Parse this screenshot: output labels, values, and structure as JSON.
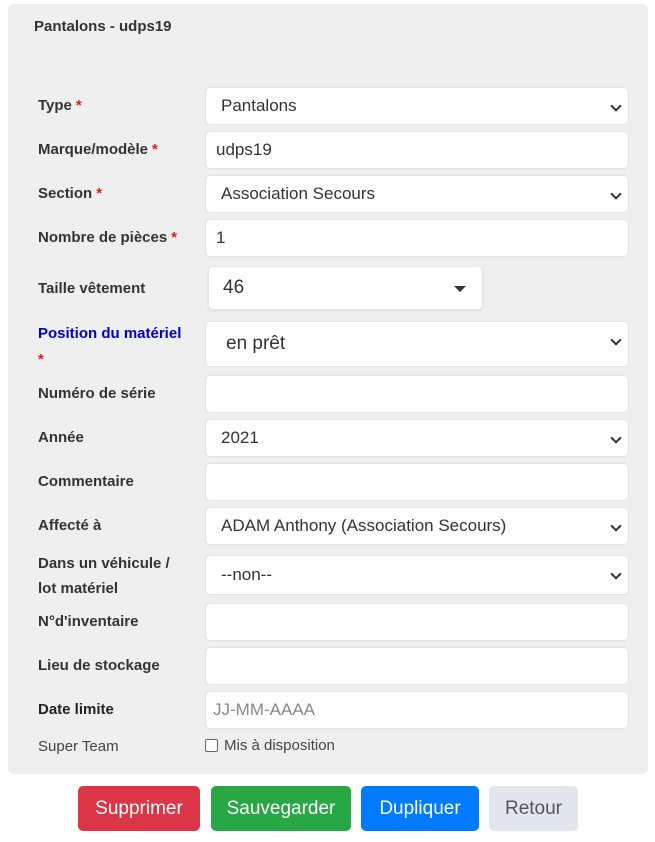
{
  "card": {
    "title": "Pantalons - udps19"
  },
  "form": {
    "type": {
      "label": "Type",
      "required_mark": "*",
      "value": "Pantalons"
    },
    "brand_model": {
      "label": "Marque/modèle",
      "required_mark": "*",
      "value": "udps19"
    },
    "section": {
      "label": "Section",
      "required_mark": "*",
      "value": "Association Secours"
    },
    "pieces": {
      "label": "Nombre de pièces",
      "required_mark": "*",
      "value": "1"
    },
    "size": {
      "label": "Taille vêtement",
      "value": "46"
    },
    "position": {
      "label": "Position du matériel",
      "required_mark": "*",
      "value": "en prêt"
    },
    "serial": {
      "label": "Numéro de série",
      "value": ""
    },
    "year": {
      "label": "Année",
      "value": "2021"
    },
    "comment": {
      "label": "Commentaire",
      "value": ""
    },
    "assigned": {
      "label": "Affecté à",
      "value": "ADAM Anthony (Association Secours)"
    },
    "vehicle": {
      "label_line1": "Dans un véhicule /",
      "label_line2": "lot matériel",
      "value": "--non--"
    },
    "inventory": {
      "label": "N°d'inventaire",
      "value": ""
    },
    "storage": {
      "label": "Lieu de stockage",
      "value": ""
    },
    "deadline": {
      "label": "Date limite",
      "placeholder": "JJ-MM-AAAA",
      "value": ""
    },
    "super_team": {
      "label": "Super Team",
      "checkbox_label": "Mis à disposition",
      "checked": false
    }
  },
  "buttons": {
    "delete": {
      "label": "Supprimer",
      "color": "#dc3545"
    },
    "save": {
      "label": "Sauvegarder",
      "color": "#28a745"
    },
    "duplicate": {
      "label": "Dupliquer",
      "color": "#007bff"
    },
    "back": {
      "label": "Retour",
      "color": "#e2e6ef"
    }
  }
}
